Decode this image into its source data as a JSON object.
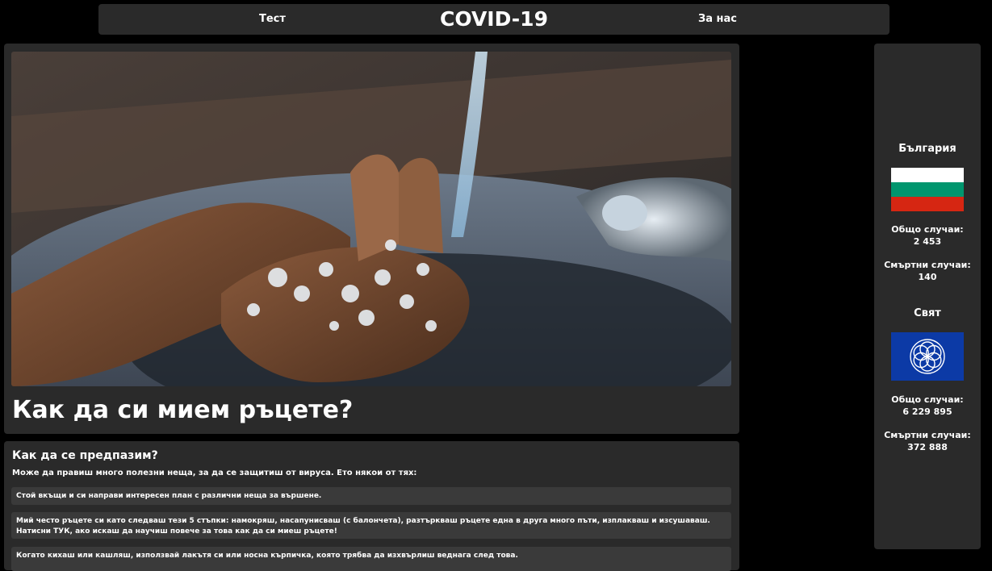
{
  "nav": {
    "test_label": "Тест",
    "brand": "COVID-19",
    "about_label": "За нас"
  },
  "hero": {
    "title": "Как да си мием ръцете?"
  },
  "prevention": {
    "title": "Как да се предпазим?",
    "intro": "Може да правиш много полезни неща, за да се защитиш от вируса. Ето някои от тях:",
    "tips": [
      "Стой вкъщи и си направи интересен план с различни неща за вършене.",
      "Мий често ръцете си като следваш тези 5 стъпки: намокряш, насапунисваш (с балончета), разтъркваш ръцете една в друга много пъти, изплакваш и изсушаваш. Натисни ТУК, ако искаш да научиш повече за това как да си миеш ръцете!",
      "Когато кихаш или кашляш, използвай лакътя си или носна кърпичка, която трябва да изхвърлиш веднага след това."
    ]
  },
  "stats": {
    "bulgaria": {
      "heading": "България",
      "total_label": "Общо случаи:",
      "total_value": "2 453",
      "deaths_label": "Смъртни случаи:",
      "deaths_value": "140",
      "flag_colors": [
        "#ffffff",
        "#00966e",
        "#d62612"
      ]
    },
    "world": {
      "heading": "Свят",
      "total_label": "Общо случаи:",
      "total_value": "6 229 895",
      "deaths_label": "Смъртни случаи:",
      "deaths_value": "372 888",
      "flag_color": "#0c3aa6"
    }
  },
  "colors": {
    "background": "#000000",
    "card": "#2a2a2a",
    "tip": "#3a3a3a",
    "text": "#ffffff"
  },
  "icons": {
    "hero_image": "hand-washing-photo",
    "bulgaria_flag": "bulgaria-flag-icon",
    "world_flag": "world-flag-icon"
  }
}
